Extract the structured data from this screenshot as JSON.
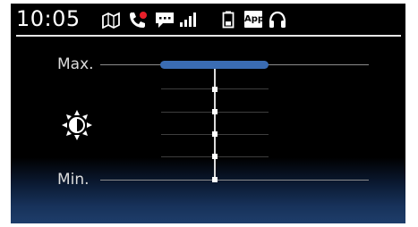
{
  "status_bar": {
    "time": "10:05",
    "app_badge": "App",
    "icons": [
      "navigation-map-icon",
      "phone-missed-call-icon",
      "message-icon",
      "signal-strength-icon",
      "battery-icon",
      "app-icon",
      "headset-icon"
    ]
  },
  "brightness": {
    "max_label": "Max.",
    "min_label": "Min.",
    "icon": "brightness-icon",
    "level_fraction": 1.0,
    "steps": 5,
    "accent_color": "#3a6cb3"
  }
}
